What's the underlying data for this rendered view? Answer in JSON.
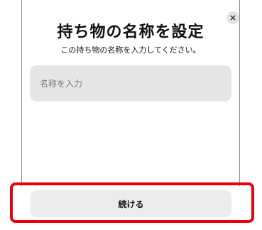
{
  "dialog": {
    "title": "持ち物の名称を設定",
    "subtitle": "この持ち物の名称を入力してください。",
    "close_label": "×"
  },
  "name_input": {
    "placeholder": "名称を入力",
    "value": ""
  },
  "actions": {
    "continue_label": "続ける"
  },
  "colors": {
    "highlight_border": "#e8000b",
    "input_background": "#e6e6e6",
    "button_background": "#ececec"
  },
  "icons": {
    "close": "close-icon"
  }
}
